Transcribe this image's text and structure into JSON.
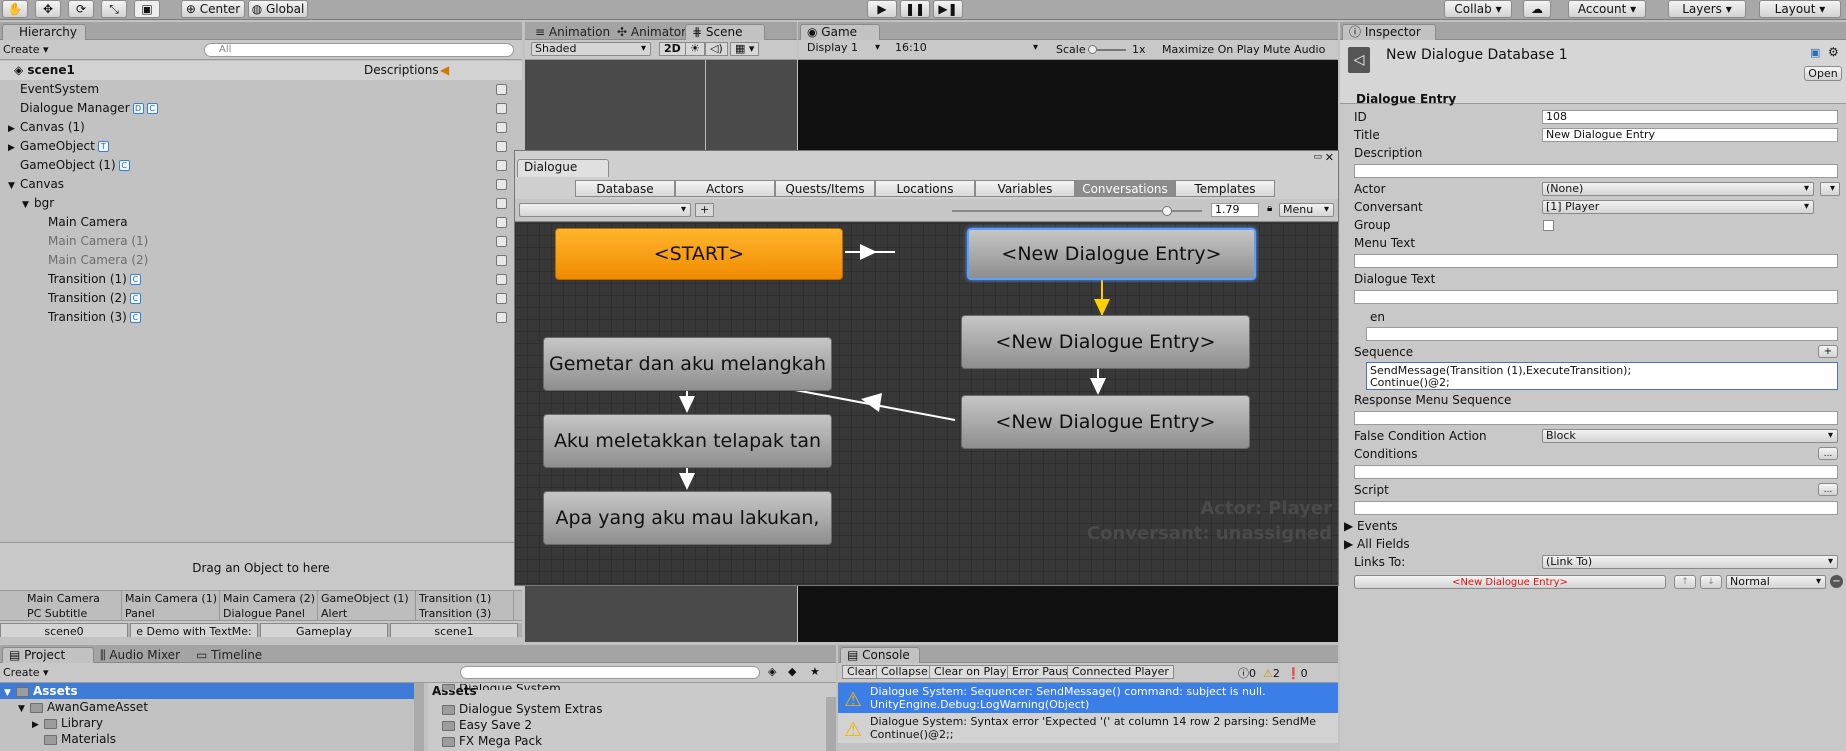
{
  "toolbar": {
    "pivot": "Center",
    "space": "Global",
    "collab": "Collab",
    "account": "Account",
    "layers": "Layers",
    "layout": "Layout"
  },
  "hierarchy": {
    "tab": "Hierarchy",
    "create": "Create",
    "search_placeholder": "All",
    "scene": "scene1",
    "descriptions": "Descriptions",
    "items": [
      {
        "label": "EventSystem",
        "indent": 0,
        "arrow": "",
        "dim": false,
        "icon": ""
      },
      {
        "label": "Dialogue Manager",
        "indent": 0,
        "arrow": "",
        "dim": false,
        "icon": "D C"
      },
      {
        "label": "Canvas (1)",
        "indent": 0,
        "arrow": "▶",
        "dim": false,
        "icon": ""
      },
      {
        "label": "GameObject",
        "indent": 0,
        "arrow": "▶",
        "dim": false,
        "icon": "T"
      },
      {
        "label": "GameObject (1)",
        "indent": 0,
        "arrow": "",
        "dim": false,
        "icon": "C"
      },
      {
        "label": "Canvas",
        "indent": 0,
        "arrow": "▼",
        "dim": false,
        "icon": ""
      },
      {
        "label": "bgr",
        "indent": 1,
        "arrow": "▼",
        "dim": false,
        "icon": ""
      },
      {
        "label": "Main Camera",
        "indent": 2,
        "arrow": "",
        "dim": false,
        "icon": ""
      },
      {
        "label": "Main Camera (1)",
        "indent": 2,
        "arrow": "",
        "dim": true,
        "icon": ""
      },
      {
        "label": "Main Camera (2)",
        "indent": 2,
        "arrow": "",
        "dim": true,
        "icon": ""
      },
      {
        "label": "Transition (1)",
        "indent": 2,
        "arrow": "",
        "dim": false,
        "icon": "C"
      },
      {
        "label": "Transition (2)",
        "indent": 2,
        "arrow": "",
        "dim": false,
        "icon": "C"
      },
      {
        "label": "Transition (3)",
        "indent": 2,
        "arrow": "",
        "dim": false,
        "icon": "C"
      }
    ]
  },
  "drag_hint": "Drag an Object to here",
  "object_grid": [
    [
      "Main Camera",
      "Main Camera (1)",
      "Main Camera (2)",
      "GameObject (1)",
      "Transition (1)"
    ],
    [
      "PC Subtitle",
      "Panel",
      "Dialogue Panel",
      "Alert",
      "Transition (3)"
    ]
  ],
  "scene_tabs": [
    "scene0",
    "e Demo with TextMe:",
    "Gameplay",
    "scene1"
  ],
  "scene_panel": {
    "tabs": [
      "Animation",
      "Animator",
      "Scene"
    ],
    "shaded": "Shaded",
    "mode2d": "2D"
  },
  "game_panel": {
    "tab": "Game",
    "display": "Display 1",
    "aspect": "16:10",
    "scale": "Scale",
    "scale_value": "1x",
    "maximize": "Maximize On Play",
    "mute": "Mute Audio"
  },
  "dialogue": {
    "title": "Dialogue",
    "tabs": [
      "Database",
      "Actors",
      "Quests/Items",
      "Locations",
      "Variables",
      "Conversations",
      "Templates"
    ],
    "active_tab": "Conversations",
    "zoom": "1.79",
    "menu": "Menu",
    "add": "+",
    "zoom_level": 0.86,
    "nodes": {
      "start": "<START>",
      "entry1": "<New Dialogue Entry>",
      "entry2": "<New Dialogue Entry>",
      "entry3": "<New Dialogue Entry>",
      "g1": "Gemetar dan aku melangkah",
      "g2": "Aku meletakkan telapak tan",
      "g3": "Apa yang aku mau lakukan,"
    },
    "actor": "Actor: Player",
    "conversant": "Conversant: unassigned"
  },
  "project": {
    "tabs": [
      "Project",
      "Audio Mixer",
      "Timeline"
    ],
    "create": "Create",
    "assets_label": "Assets",
    "tree": [
      "Assets",
      "AwanGameAsset",
      "Library",
      "Materials"
    ],
    "files": [
      "Dialogue System",
      "Dialogue System Extras",
      "Easy Save 2",
      "FX Mega Pack"
    ]
  },
  "console": {
    "tab": "Console",
    "buttons": [
      "Clear",
      "Collapse",
      "Clear on Play",
      "Error Pause",
      "Connected Player"
    ],
    "counts": [
      "0",
      "2",
      "0"
    ],
    "messages": [
      {
        "line1": "Dialogue System: Sequencer: SendMessage() command: subject is null.",
        "line2": "UnityEngine.Debug:LogWarning(Object)",
        "selected": true
      },
      {
        "line1": "Dialogue System: Syntax error 'Expected '(' at column 14 row 2 parsing: SendMe",
        "line2": "Continue()@2;;",
        "selected": false
      }
    ]
  },
  "inspector": {
    "tab": "Inspector",
    "name": "New Dialogue Database 1",
    "open": "Open",
    "section": "Dialogue Entry",
    "id_label": "ID",
    "id": "108",
    "title_label": "Title",
    "title": "New Dialogue Entry",
    "description_label": "Description",
    "actor_label": "Actor",
    "actor": "(None)",
    "conversant_label": "Conversant",
    "conversant": "[1] Player",
    "group_label": "Group",
    "menu_text_label": "Menu Text",
    "dialogue_text_label": "Dialogue Text",
    "lang": "en",
    "sequence_label": "Sequence",
    "sequence_line1": "SendMessage(Transition (1),ExecuteTransition);",
    "sequence_line2": "Continue()@2;",
    "response_label": "Response Menu Sequence",
    "false_cond_label": "False Condition Action",
    "false_cond": "Block",
    "conditions_label": "Conditions",
    "script_label": "Script",
    "events_label": "Events",
    "all_fields_label": "All Fields",
    "links_label": "Links To:",
    "links": "(Link To)",
    "link_target": "<New Dialogue Entry>",
    "priority": "Normal",
    "ellipsis": "..."
  }
}
